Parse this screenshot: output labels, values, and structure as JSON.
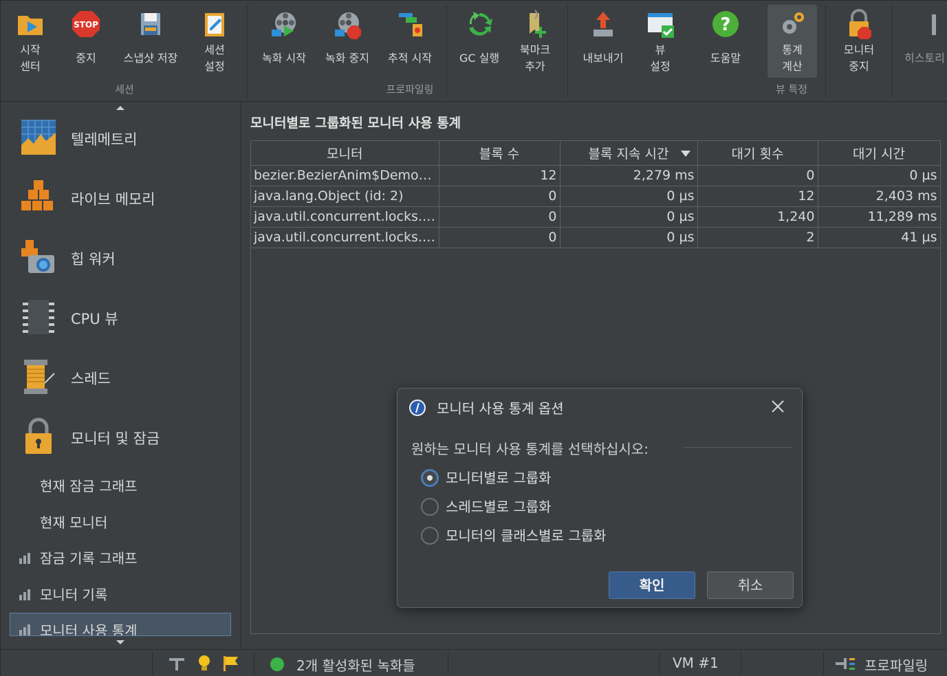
{
  "toolbar": {
    "buttons": [
      {
        "label": "시작\n센터",
        "icon": "start-center-icon"
      },
      {
        "label": "중지",
        "icon": "stop-icon"
      },
      {
        "label": "스냅샷 저장",
        "icon": "save-snapshot-icon"
      },
      {
        "label": "세션\n설정",
        "icon": "session-settings-icon"
      },
      {
        "label": "녹화 시작",
        "icon": "start-recording-icon"
      },
      {
        "label": "녹화 중지",
        "icon": "stop-recording-icon"
      },
      {
        "label": "추적 시작",
        "icon": "start-tracking-icon"
      },
      {
        "label": "GC 실행",
        "icon": "gc-icon"
      },
      {
        "label": "북마크\n추가",
        "icon": "add-bookmark-icon"
      },
      {
        "label": "내보내기",
        "icon": "export-icon"
      },
      {
        "label": "뷰\n설정",
        "icon": "view-settings-icon"
      },
      {
        "label": "도움말",
        "icon": "help-icon"
      },
      {
        "label": "통계\n계산",
        "icon": "compute-statistics-icon"
      },
      {
        "label": "모니터\n중지",
        "icon": "stop-monitor-icon"
      },
      {
        "label": "히스토리",
        "icon": "history-icon"
      }
    ],
    "groups": {
      "session": "세션",
      "profiling": "프로파일링",
      "view_specific": "뷰 특정"
    }
  },
  "sidebar": {
    "items": [
      {
        "label": "텔레메트리",
        "icon": "telemetry-icon"
      },
      {
        "label": "라이브 메모리",
        "icon": "live-memory-icon"
      },
      {
        "label": "힙 워커",
        "icon": "heap-walker-icon"
      },
      {
        "label": "CPU 뷰",
        "icon": "cpu-icon"
      },
      {
        "label": "스레드",
        "icon": "threads-icon"
      },
      {
        "label": "모니터 및 잠금",
        "icon": "lock-icon"
      }
    ],
    "sub_items": [
      {
        "label": "현재 잠금 그래프"
      },
      {
        "label": "현재 모니터"
      },
      {
        "label": "잠금 기록 그래프"
      },
      {
        "label": "모니터 기록"
      },
      {
        "label": "모니터 사용 통계"
      }
    ]
  },
  "main": {
    "title": "모니터별로 그룹화된 모니터 사용 통계",
    "columns": [
      "모니터",
      "블록 수",
      "블록 지속 시간",
      "대기 횟수",
      "대기 시간"
    ],
    "rows": [
      [
        "bezier.BezierAnim$Demo (i...",
        "12",
        "2,279 ms",
        "0",
        "0 µs"
      ],
      [
        "java.lang.Object (id: 2)",
        "0",
        "0 µs",
        "12",
        "2,403 ms"
      ],
      [
        "java.util.concurrent.locks.A...",
        "0",
        "0 µs",
        "1,240",
        "11,289 ms"
      ],
      [
        "java.util.concurrent.locks.R...",
        "0",
        "0 µs",
        "2",
        "41 µs"
      ]
    ]
  },
  "status": {
    "recordings": "2개 활성화된 녹화들",
    "vm": "VM #1",
    "mode": "프로파일링"
  },
  "dialog": {
    "title": "모니터 사용 통계 옵션",
    "prompt": "원하는 모니터 사용 통계를 선택하십시오:",
    "options": [
      "모니터별로 그룹화",
      "스레드별로 그룹화",
      "모니터의 클래스별로 그룹화"
    ],
    "selected": 0,
    "ok": "확인",
    "cancel": "취소"
  },
  "colors": {
    "accent": "#4a7bb7",
    "background": "#3c3f41",
    "selection": "#485563"
  }
}
